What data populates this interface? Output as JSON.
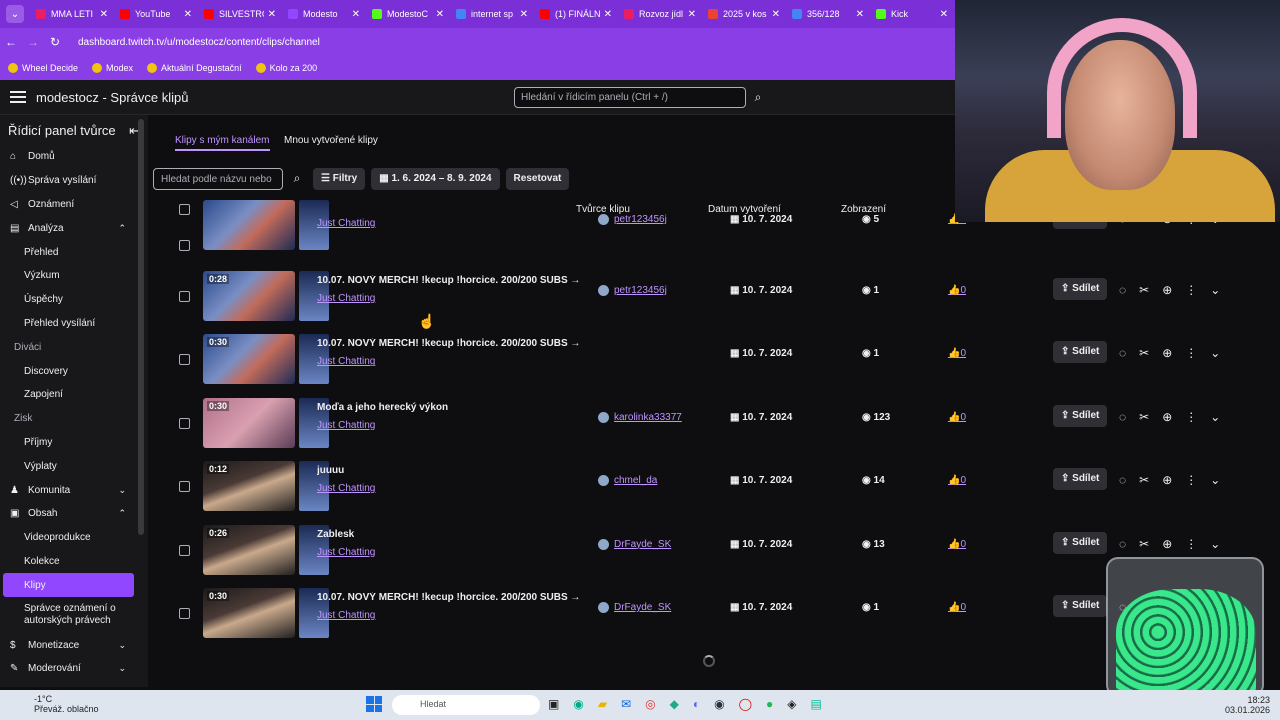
{
  "browser": {
    "tabs": [
      {
        "title": "MMA LETI",
        "color": "#e91e63"
      },
      {
        "title": "YouTube",
        "color": "#ff0000"
      },
      {
        "title": "SILVESTRO",
        "color": "#ff0000"
      },
      {
        "title": "Modesto",
        "color": "#9146ff"
      },
      {
        "title": "ModestoC",
        "color": "#53fc18"
      },
      {
        "title": "internet sp",
        "color": "#4285f4"
      },
      {
        "title": "(1) FINÁLN",
        "color": "#ff0000"
      },
      {
        "title": "Rozvoz jídl",
        "color": "#e91e63"
      },
      {
        "title": "2025 v kos",
        "color": "#ea4335"
      },
      {
        "title": "356/128",
        "color": "#4285f4"
      },
      {
        "title": "Kick",
        "color": "#53fc18"
      }
    ],
    "url": "dashboard.twitch.tv/u/modestocz/content/clips/channel",
    "bookmarks": [
      "Wheel Decide",
      "Modex",
      "Aktuální Degustační",
      "Kolo za 200"
    ]
  },
  "topnav": {
    "title": "modestocz - Správce klipů",
    "search_placeholder": "Hledání v řídicím panelu (Ctrl + /)"
  },
  "sidebar": {
    "heading": "Řídicí panel tvůrce",
    "items": [
      {
        "label": "Domů",
        "icon": "home-icon",
        "type": "top"
      },
      {
        "label": "Správa vysílání",
        "icon": "broadcast-icon",
        "type": "top"
      },
      {
        "label": "Oznámení",
        "icon": "megaphone-icon",
        "type": "top"
      },
      {
        "label": "Analýza",
        "icon": "chart-icon",
        "type": "top",
        "chev": "⌃"
      },
      {
        "label": "Přehled",
        "type": "sub"
      },
      {
        "label": "Výzkum",
        "type": "sub"
      },
      {
        "label": "Úspěchy",
        "type": "sub"
      },
      {
        "label": "Přehled vysílání",
        "type": "sub"
      },
      {
        "label": "Diváci",
        "type": "grp"
      },
      {
        "label": "Discovery",
        "type": "sub"
      },
      {
        "label": "Zapojení",
        "type": "sub"
      },
      {
        "label": "Zisk",
        "type": "grp"
      },
      {
        "label": "Příjmy",
        "type": "sub"
      },
      {
        "label": "Výplaty",
        "type": "sub"
      },
      {
        "label": "Komunita",
        "icon": "community-icon",
        "type": "top",
        "chev": "⌄"
      },
      {
        "label": "Obsah",
        "icon": "content-icon",
        "type": "top",
        "chev": "⌃"
      },
      {
        "label": "Videoprodukce",
        "type": "sub"
      },
      {
        "label": "Kolekce",
        "type": "sub"
      },
      {
        "label": "Klipy",
        "type": "sub",
        "active": true
      },
      {
        "label": "Správce oznámení o autorských právech",
        "type": "sub2"
      },
      {
        "label": "Monetizace",
        "icon": "money-icon",
        "type": "top",
        "chev": "⌄"
      },
      {
        "label": "Moderování",
        "icon": "shield-icon",
        "type": "top",
        "chev": "⌄"
      }
    ]
  },
  "main": {
    "tab_my": "Klipy s mým kanálem",
    "tab_created": "Mnou vytvořené klipy",
    "search_placeholder": "Hledat podle názvu nebo",
    "filters": "Filtry",
    "daterange": "1. 6. 2024 – 8. 9. 2024",
    "reset": "Resetovat",
    "columns": {
      "creator": "Tvůrce klipu",
      "date": "Datum vytvoření",
      "views": "Zobrazení"
    },
    "partial_row": {
      "category": "Just Chatting",
      "author": "petr123456j",
      "date": "10. 7. 2024",
      "views": "5",
      "likes": "0",
      "share": "Sdílet"
    },
    "rows": [
      {
        "duration": "0:28",
        "title": "10.07. NOVÝ MERCH! !kecup !horcice. 200/200 SUBS → ...",
        "category": "Just Chatting",
        "author": "petr123456j",
        "date": "10. 7. 2024",
        "views": "1",
        "likes": "0",
        "share": "Sdílet",
        "thumb": "blue"
      },
      {
        "duration": "0:30",
        "title": "10.07. NOVÝ MERCH! !kecup !horcice. 200/200 SUBS → ...",
        "category": "Just Chatting",
        "author": "",
        "date": "10. 7. 2024",
        "views": "1",
        "likes": "0",
        "share": "Sdílet",
        "thumb": "blue"
      },
      {
        "duration": "0:30",
        "title": "Moďa a jeho herecký výkon",
        "category": "Just Chatting",
        "author": "karolinka33377",
        "date": "10. 7. 2024",
        "views": "123",
        "likes": "0",
        "share": "Sdílet",
        "thumb": "pink"
      },
      {
        "duration": "0:12",
        "title": "juuuu",
        "category": "Just Chatting",
        "author": "chmel_da",
        "date": "10. 7. 2024",
        "views": "14",
        "likes": "0",
        "share": "Sdílet",
        "thumb": "face"
      },
      {
        "duration": "0:26",
        "title": "Zablesk",
        "category": "Just Chatting",
        "author": "DrFayde_SK",
        "date": "10. 7. 2024",
        "views": "13",
        "likes": "0",
        "share": "Sdílet",
        "thumb": "face"
      },
      {
        "duration": "0:30",
        "title": "10.07. NOVÝ MERCH! !kecup !horcice. 200/200 SUBS → ...",
        "category": "Just Chatting",
        "author": "DrFayde_SK",
        "date": "10. 7. 2024",
        "views": "1",
        "likes": "0",
        "share": "Sdílet",
        "thumb": "face"
      }
    ]
  },
  "taskbar": {
    "temp": "-1°C",
    "weather": "Převáž. oblačno",
    "search": "Hledat",
    "time": "18:23",
    "date": "03.01.2026"
  }
}
